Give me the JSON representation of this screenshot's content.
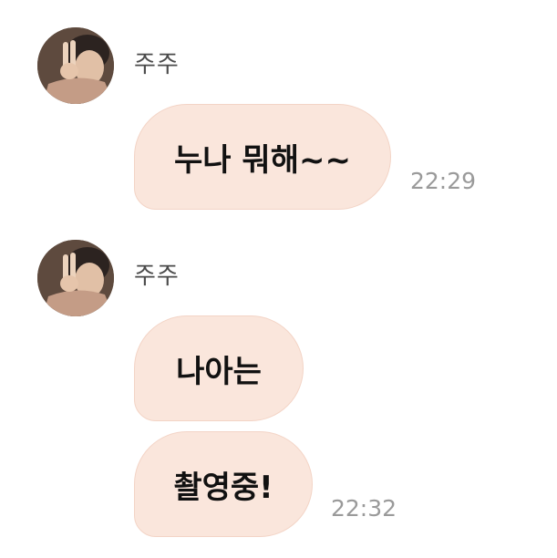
{
  "messages": [
    {
      "sender": "주주",
      "avatar": "profile-photo-peace-sign",
      "bubbles": [
        "누나 뭐해~~"
      ],
      "time": "22:29"
    },
    {
      "sender": "주주",
      "avatar": "profile-photo-peace-sign",
      "bubbles": [
        "나아는",
        "촬영중!"
      ],
      "time": "22:32"
    }
  ],
  "colors": {
    "bubble": "#fae6dc",
    "bubble_border": "#f3d4c6",
    "name": "#4a4a4a",
    "time": "#9a9a9a"
  }
}
